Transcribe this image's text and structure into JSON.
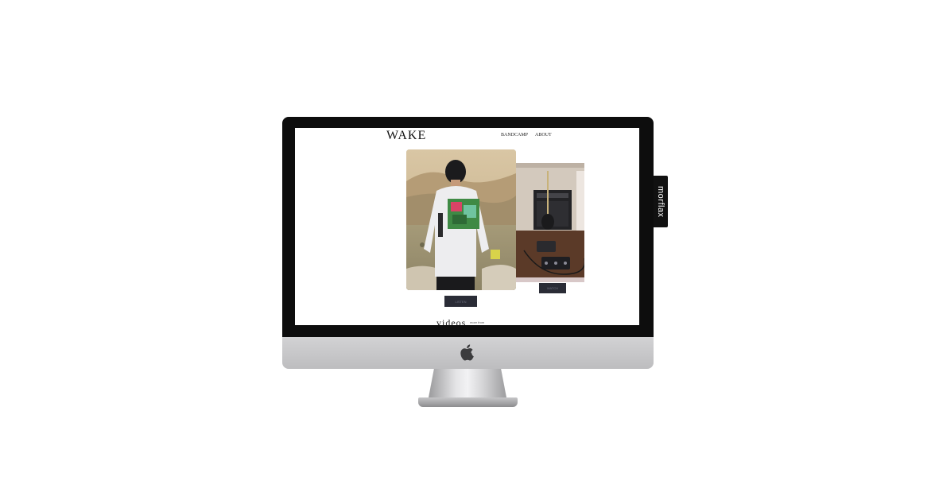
{
  "site": {
    "logo": "WAKE",
    "nav": [
      "BANDCAMP",
      "ABOUT"
    ]
  },
  "buttons": {
    "main_label": "LISTEN",
    "side_label": "WATCH"
  },
  "section": {
    "heading": "videos",
    "sub": "more from"
  },
  "side_tab": {
    "label": "morflax"
  },
  "colors": {
    "bezel": "#0d0d0d",
    "button": "#2a2c36",
    "tab": "#111111"
  }
}
